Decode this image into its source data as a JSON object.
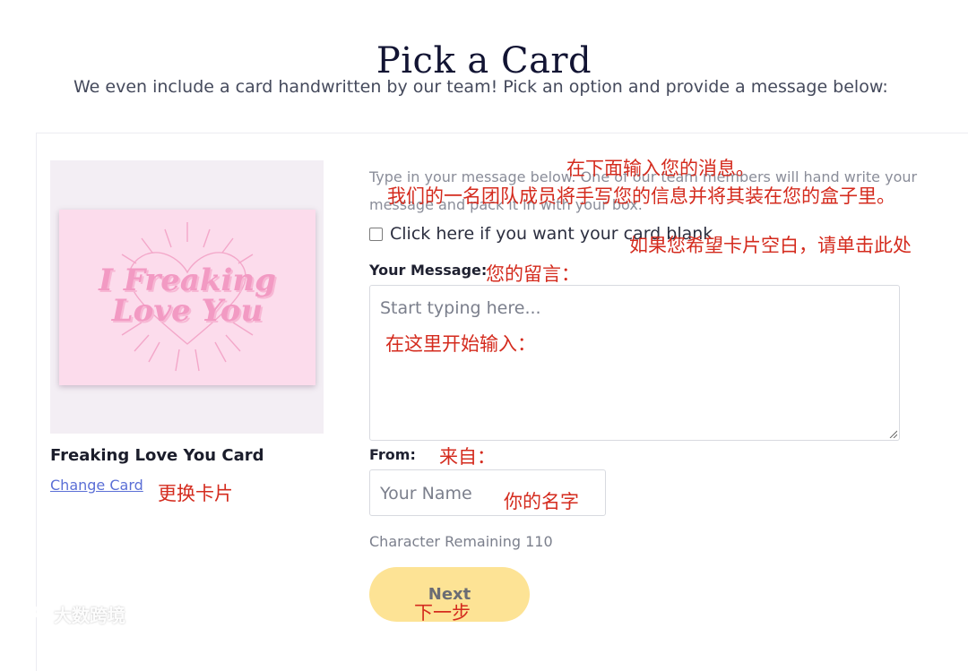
{
  "header": {
    "title": "Pick a Card",
    "subtitle": "We even include a card handwritten by our team! Pick an option and provide a message below:"
  },
  "card": {
    "art_line1": "I Freaking",
    "art_line2": "Love You",
    "name": "Freaking Love You Card",
    "change_label": "Change Card"
  },
  "form": {
    "instructions": "Type in your message below. One of our team members will hand write your message and pack it in with your box.",
    "blank_checkbox_label": "Click here if you want your card blank",
    "blank_checked": false,
    "message_label": "Your Message:",
    "message_placeholder": "Start typing here...",
    "message_value": "",
    "from_label": "From:",
    "name_placeholder": "Your Name",
    "name_value": "",
    "char_remaining": "Character Remaining 110",
    "next_label": "Next"
  },
  "annotations": {
    "instructions_1": "在下面输入您的消息。",
    "instructions_2": "我们的一名团队成员将手写您的信息并将其装在您的盒子里。",
    "blank": "如果您希望卡片空白，请单击此处",
    "message": "您的留言：",
    "start_typing": "在这里开始输入：",
    "from": "来自：",
    "your_name": "你的名字",
    "change_card": "更换卡片",
    "next": "下一步"
  },
  "watermark": {
    "text": "大数跨境"
  },
  "colors": {
    "accent_button": "#fde395",
    "link": "#5b6fd6",
    "annotation": "#d42b1e",
    "card_pink": "#fcdcec"
  }
}
